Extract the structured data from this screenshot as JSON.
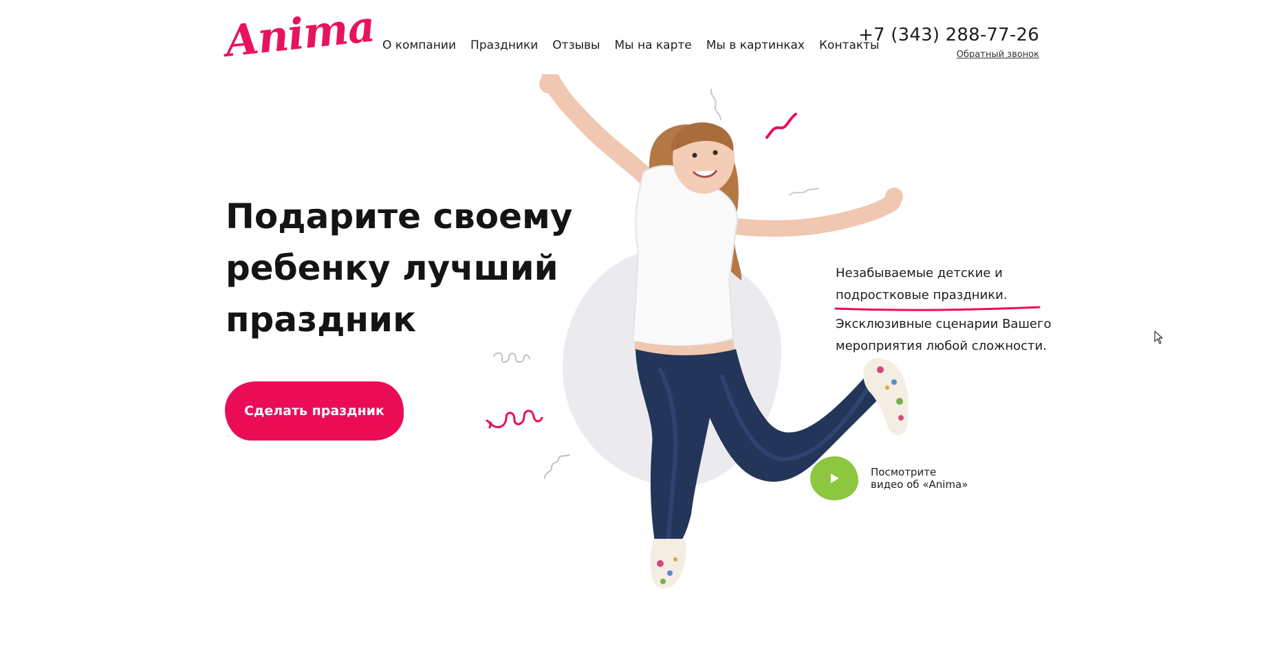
{
  "brand": {
    "logo_text": "Anima",
    "accent_color": "#ea0d56",
    "green_color": "#8dc63f"
  },
  "nav": {
    "items": [
      {
        "label": "О компании"
      },
      {
        "label": "Праздники"
      },
      {
        "label": "Отзывы"
      },
      {
        "label": "Мы на карте"
      },
      {
        "label": "Мы в картинках"
      },
      {
        "label": "Контакты"
      }
    ]
  },
  "contact": {
    "phone": "+7 (343) 288-77-26",
    "callback_label": "Обратный звонок"
  },
  "hero": {
    "title_line1": "Подарите своему",
    "title_line2": "ребенку лучший",
    "title_line3": "праздник",
    "cta_label": "Сделать праздник",
    "desc_line1": "Незабываемые детские и",
    "desc_line2": "подростковые праздники.",
    "desc_line3": "Эксклюзивные сценарии Вашего",
    "desc_line4": "мероприятия любой сложности.",
    "video_line1": "Посмотрите",
    "video_line2": "видео об «Anima»",
    "image_subject": "jumping-girl-photo"
  },
  "icons": {
    "play": "play-icon",
    "cursor": "mouse-cursor-icon"
  }
}
